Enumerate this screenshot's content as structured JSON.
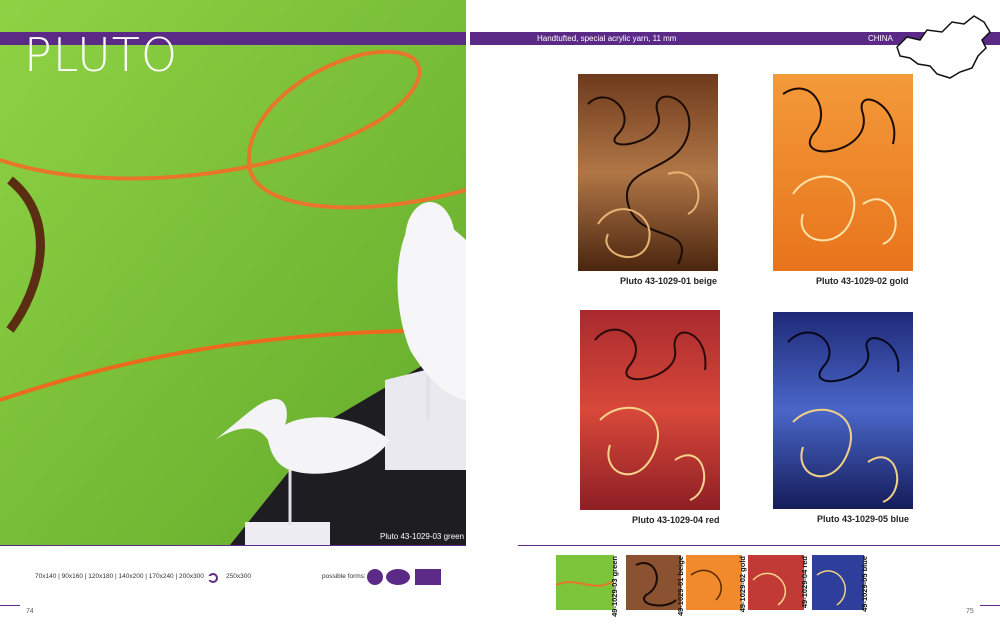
{
  "left": {
    "title": "PLUTO",
    "hero_caption": "Pluto 43-1029-03 green",
    "sizes_text": "70x140 | 90x160 | 120x180 | 140x200 | 170x240 | 200x300",
    "round_size": "250x300",
    "possible_forms_label": "possible forms:",
    "page_number": "74"
  },
  "right": {
    "spec": "Handtufted, special acrylic yarn, 11 mm",
    "country": "CHINA",
    "page_number": "75",
    "rugs": [
      {
        "label": "Pluto 43-1029-01 beige"
      },
      {
        "label": "Pluto 43-1029-02 gold"
      },
      {
        "label": "Pluto 43-1029-04 red"
      },
      {
        "label": "Pluto 43-1029-05 blue"
      }
    ],
    "swatches": [
      {
        "label": "49-1029-03 green"
      },
      {
        "label": "49-1029-01 beige"
      },
      {
        "label": "49-1029-02 gold"
      },
      {
        "label": "49-1029-04 red"
      },
      {
        "label": "49-1029-05 blue"
      }
    ]
  },
  "colors": {
    "accent": "#5b2a86",
    "green_rug": "#7cc43a",
    "beige_rug": "#7a4423",
    "gold_rug": "#f08a2a",
    "red_rug": "#c23a35",
    "blue_rug": "#2d3f9a"
  }
}
